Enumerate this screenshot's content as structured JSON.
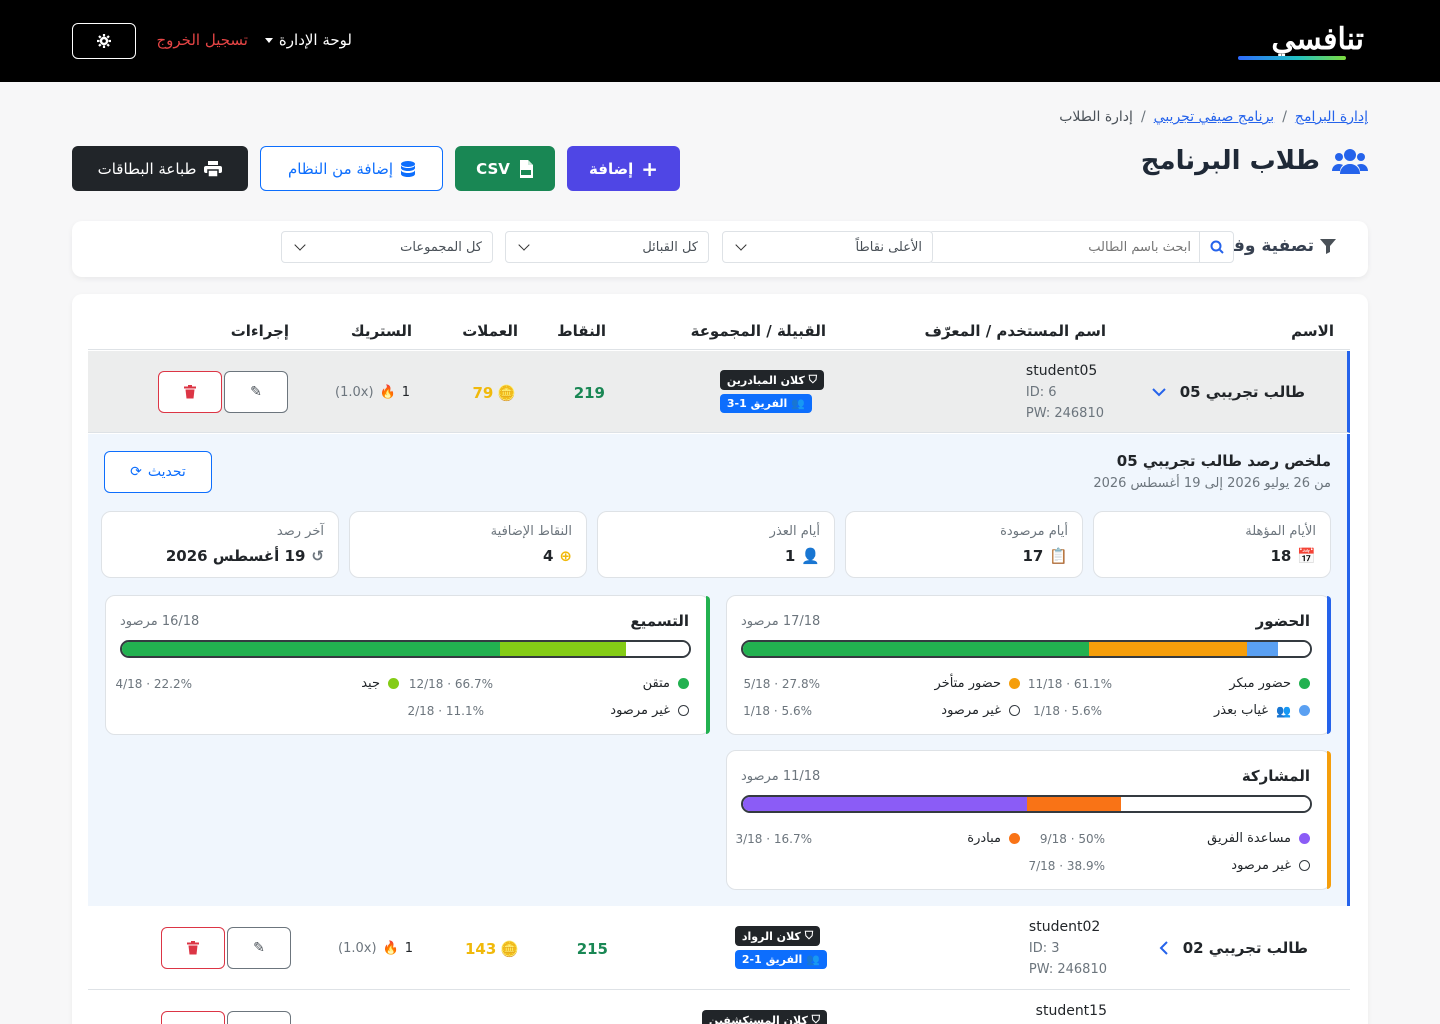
{
  "navbar": {
    "logo_text": "تنافسي",
    "admin_label": "لوحة الإدارة",
    "logout_label": "تسجيل الخروج",
    "theme_icon": "gear-icon"
  },
  "breadcrumb": {
    "items": [
      "إدارة البرامج",
      "برنامج صيفي تجريبي"
    ],
    "current": "إدارة الطلاب"
  },
  "page": {
    "title": "طلاب البرنامج",
    "buttons": {
      "add": "إضافة",
      "csv": "CSV",
      "add_from_system": "إضافة من النظام",
      "print_cards": "طباعة البطاقات"
    }
  },
  "filters": {
    "label": "تصفية وفرز:",
    "search_placeholder": "ابحث باسم الطالب",
    "clear": "×",
    "sort_selected": "الأعلى نقاطاً",
    "tribe_selected": "كل القبائل",
    "group_selected": "كل المجموعات"
  },
  "table": {
    "headers": {
      "name": "الاسم",
      "username": "اسم المستخدم / المعرّف",
      "tribe_group": "القبيلة / المجموعة",
      "points": "النقاط",
      "coins": "العملات",
      "streak": "الستريك",
      "actions": "إجراءات"
    },
    "rows": [
      {
        "name": "طالب تجريبي 05",
        "username": "student05",
        "id": "ID: 6",
        "pw": "PW: 246810",
        "tribe": "كلان المبادرين",
        "group": "الفريق 1-3",
        "points": "219",
        "coins": "79",
        "streak": "1",
        "multiplier": "(1.0x)",
        "expanded": true
      },
      {
        "name": "طالب تجريبي 02",
        "username": "student02",
        "id": "ID: 3",
        "pw": "PW: 246810",
        "tribe": "كلان الرواد",
        "group": "الفريق 1-2",
        "points": "215",
        "coins": "143",
        "streak": "1",
        "multiplier": "(1.0x)",
        "expanded": false
      },
      {
        "username": "student15",
        "tribe": "كلان المستكشفين"
      }
    ]
  },
  "detail": {
    "title": "ملخص رصد طالب تجريبي 05",
    "range": "من 26 يوليو 2026 إلى 19 أغسطس 2026",
    "refresh": "تحديث",
    "stats": [
      {
        "label": "الأيام المؤهلة",
        "value": "18",
        "icon": "calendar-check-icon"
      },
      {
        "label": "أيام مرصودة",
        "value": "17",
        "icon": "clipboard-check-icon"
      },
      {
        "label": "أيام العذر",
        "value": "1",
        "icon": "user-clock-icon"
      },
      {
        "label": "النقاط الإضافية",
        "value": "4",
        "icon": "plus-circle-icon"
      },
      {
        "label": "آخر رصد",
        "value": "19 أغسطس 2026",
        "icon": "history-icon"
      }
    ],
    "attendance": {
      "title": "الحضور",
      "count": "17/18 مرصود",
      "accent": "#2563eb",
      "segments": [
        {
          "color": "#22b150",
          "fraction": 0.611
        },
        {
          "color": "#f59e0b",
          "fraction": 0.278
        },
        {
          "color": "#5aa0f2",
          "fraction": 0.056
        },
        {
          "color": "#ffffff",
          "fraction": 0.056
        }
      ],
      "legend": [
        {
          "label": "حضور مبكر",
          "value": "61.1% · 11/18",
          "color": "#22b150"
        },
        {
          "label": "حضور متأخر",
          "value": "27.8% · 5/18",
          "color": "#f59e0b"
        },
        {
          "label": "غياب بعذر",
          "value": "5.6% · 1/18",
          "color": "#5aa0f2"
        },
        {
          "label": "غير مرصود",
          "value": "5.6% · 1/18",
          "color": "hollow"
        }
      ]
    },
    "recitation": {
      "title": "التسميع",
      "count": "16/18 مرصود",
      "accent": "#22b150",
      "segments": [
        {
          "color": "#22b150",
          "fraction": 0.667
        },
        {
          "color": "#84cc16",
          "fraction": 0.222
        },
        {
          "color": "#ffffff",
          "fraction": 0.111
        }
      ],
      "legend": [
        {
          "label": "متقن",
          "value": "66.7% · 12/18",
          "color": "#22b150"
        },
        {
          "label": "جيد",
          "value": "22.2% · 4/18",
          "color": "#84cc16"
        },
        {
          "label": "غير مرصود",
          "value": "11.1% · 2/18",
          "color": "hollow"
        }
      ]
    },
    "participation": {
      "title": "المشاركة",
      "count": "11/18 مرصود",
      "accent": "#f59e0b",
      "segments": [
        {
          "color": "#8b5cf6",
          "fraction": 0.5
        },
        {
          "color": "#f97316",
          "fraction": 0.167
        },
        {
          "color": "#ffffff",
          "fraction": 0.333
        }
      ],
      "legend": [
        {
          "label": "مساعدة الفريق",
          "value": "50% · 9/18",
          "color": "#8b5cf6"
        },
        {
          "label": "مبادرة",
          "value": "16.7% · 3/18",
          "color": "#f97316"
        },
        {
          "label": "غير مرصود",
          "value": "38.9% · 7/18",
          "color": "hollow"
        }
      ]
    }
  }
}
